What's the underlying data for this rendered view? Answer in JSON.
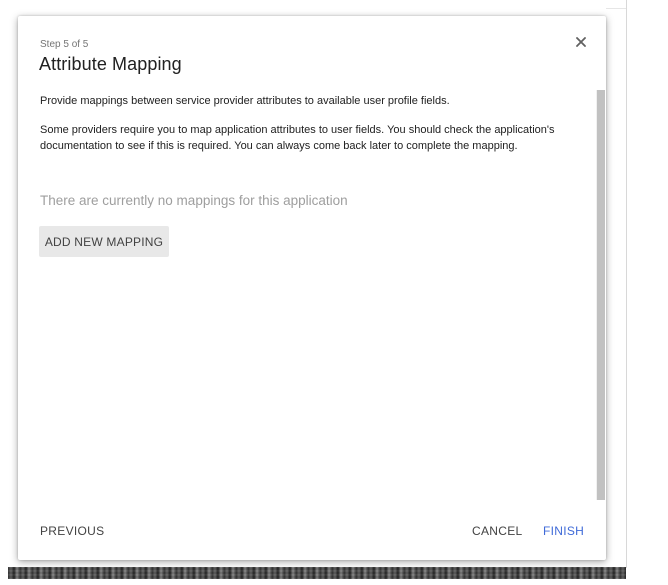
{
  "dialog": {
    "step": "Step 5 of 5",
    "title": "Attribute Mapping",
    "description_1": "Provide mappings between service provider attributes to available user profile fields.",
    "description_2": "Some providers require you to map application attributes to user fields. You should check the application's documentation to see if this is required. You can always come back later to complete the mapping.",
    "empty_message": "There are currently no mappings for this application",
    "add_button_label": "ADD NEW MAPPING",
    "close_icon": "close-icon"
  },
  "footer": {
    "previous_label": "PREVIOUS",
    "cancel_label": "CANCEL",
    "finish_label": "FINISH"
  },
  "colors": {
    "accent": "#3f6ad8",
    "muted_text": "#9e9e9e",
    "button_bg": "#e8e8e8"
  }
}
